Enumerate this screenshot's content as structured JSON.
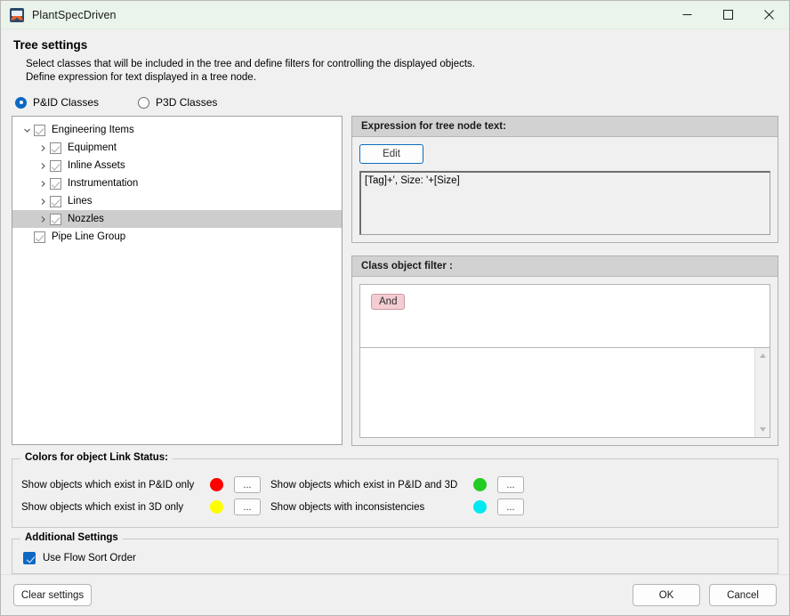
{
  "window": {
    "title": "PlantSpecDriven",
    "icon": "app-icon",
    "minimize_label": "—",
    "maximize_label": "□",
    "close_label": "✕"
  },
  "header": {
    "title": "Tree settings",
    "description_line1": "Select classes that will be included in the tree and define filters for controlling the displayed objects.",
    "description_line2": "Define expression for text displayed in a tree node."
  },
  "class_mode": {
    "options": [
      {
        "label": "P&ID Classes",
        "selected": true
      },
      {
        "label": "P3D Classes",
        "selected": false
      }
    ]
  },
  "tree": {
    "nodes": [
      {
        "label": "Engineering Items",
        "depth": 0,
        "twisty": "expanded",
        "checked": true,
        "selected": false
      },
      {
        "label": "Equipment",
        "depth": 1,
        "twisty": "collapsed",
        "checked": true,
        "selected": false
      },
      {
        "label": "Inline Assets",
        "depth": 1,
        "twisty": "collapsed",
        "checked": true,
        "selected": false
      },
      {
        "label": "Instrumentation",
        "depth": 1,
        "twisty": "collapsed",
        "checked": true,
        "selected": false
      },
      {
        "label": "Lines",
        "depth": 1,
        "twisty": "collapsed",
        "checked": true,
        "selected": false
      },
      {
        "label": "Nozzles",
        "depth": 1,
        "twisty": "collapsed",
        "checked": true,
        "selected": true
      },
      {
        "label": "Pipe Line Group",
        "depth": 0,
        "twisty": "none",
        "checked": true,
        "selected": false
      }
    ]
  },
  "expression_panel": {
    "header": "Expression for tree node text:",
    "edit_button": "Edit",
    "expression_value": "[Tag]+', Size: '+[Size]"
  },
  "filter_panel": {
    "header": "Class object filter :",
    "chip_label": "And",
    "scroll_up_icon": "triangle-up-icon",
    "scroll_down_icon": "triangle-down-icon"
  },
  "colors_section": {
    "legend": "Colors for object Link Status:",
    "left_rows": [
      {
        "label": "Show objects which exist in P&ID only",
        "color": "#fe0000",
        "button": "..."
      },
      {
        "label": "Show objects which exist in 3D only",
        "color": "#fdfd00",
        "button": "..."
      }
    ],
    "right_rows": [
      {
        "label": "Show objects which exist in P&ID and 3D",
        "color": "#22cc22",
        "button": "..."
      },
      {
        "label": "Show objects with inconsistencies",
        "color": "#00e8f0",
        "button": "..."
      }
    ]
  },
  "additional_settings": {
    "legend": "Additional Settings",
    "flow_sort_label": "Use Flow Sort Order",
    "flow_sort_checked": true
  },
  "footer": {
    "clear_settings": "Clear settings",
    "ok": "OK",
    "cancel": "Cancel"
  }
}
